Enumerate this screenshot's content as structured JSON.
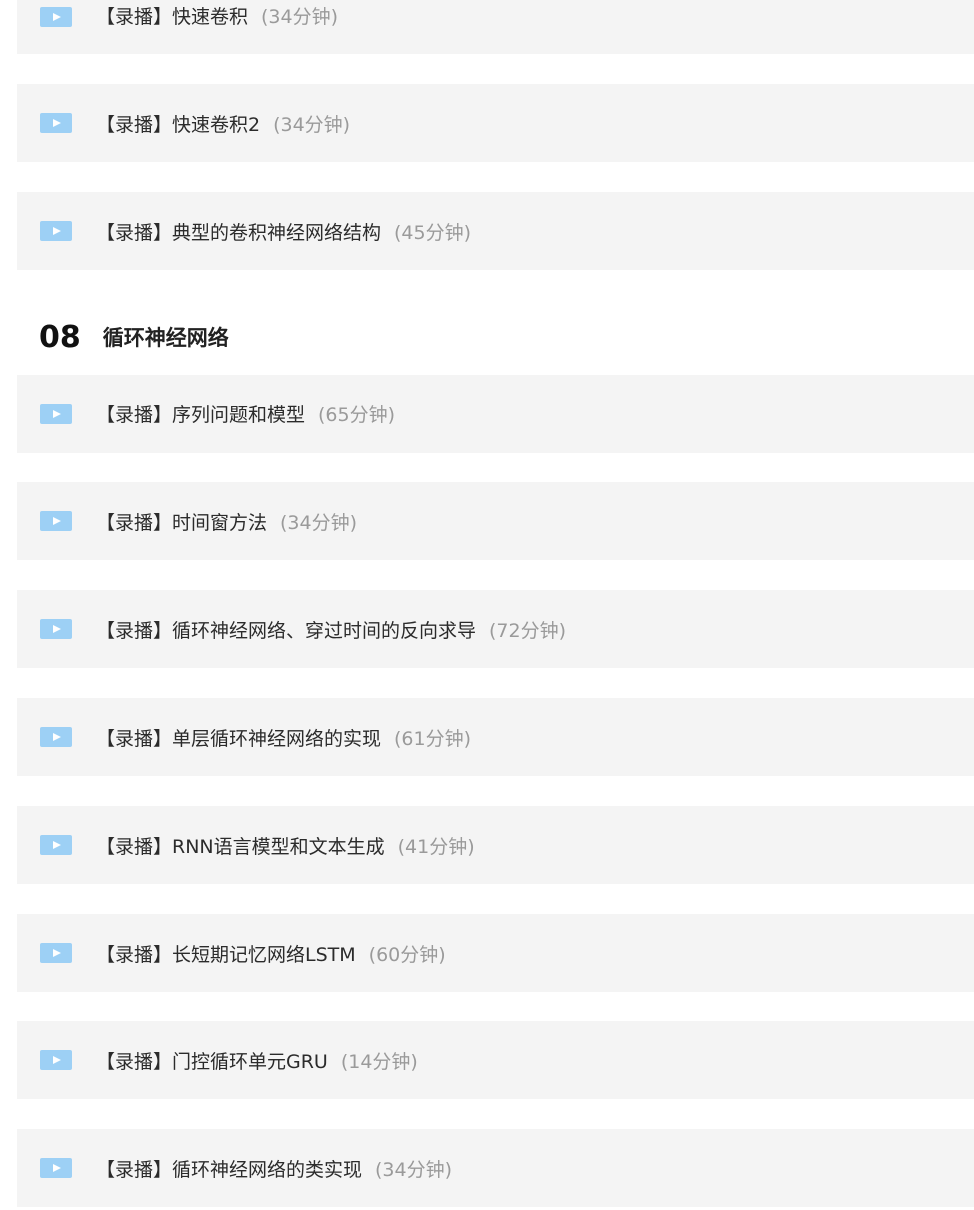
{
  "lessons_top": [
    {
      "title": "【录播】快速卷积",
      "duration": "(34分钟)"
    },
    {
      "title": "【录播】快速卷积2",
      "duration": "(34分钟)"
    },
    {
      "title": "【录播】典型的卷积神经网络结构",
      "duration": "(45分钟)"
    }
  ],
  "section": {
    "number": "08",
    "title": "循环神经网络"
  },
  "lessons": [
    {
      "title": "【录播】序列问题和模型",
      "duration": "(65分钟)"
    },
    {
      "title": "【录播】时间窗方法",
      "duration": "(34分钟)"
    },
    {
      "title": "【录播】循环神经网络、穿过时间的反向求导",
      "duration": "(72分钟)"
    },
    {
      "title": "【录播】单层循环神经网络的实现",
      "duration": "(61分钟)"
    },
    {
      "title": "【录播】RNN语言模型和文本生成",
      "duration": "(41分钟)"
    },
    {
      "title": "【录播】长短期记忆网络LSTM",
      "duration": "(60分钟)"
    },
    {
      "title": "【录播】门控循环单元GRU",
      "duration": "(14分钟)"
    },
    {
      "title": "【录播】循环神经网络的类实现",
      "duration": "(34分钟)"
    }
  ],
  "colors": {
    "row_background": "#f4f4f4",
    "play_icon": "#9dd0f5",
    "title_text": "#2b2b2b",
    "duration_text": "#9a9a9a"
  }
}
